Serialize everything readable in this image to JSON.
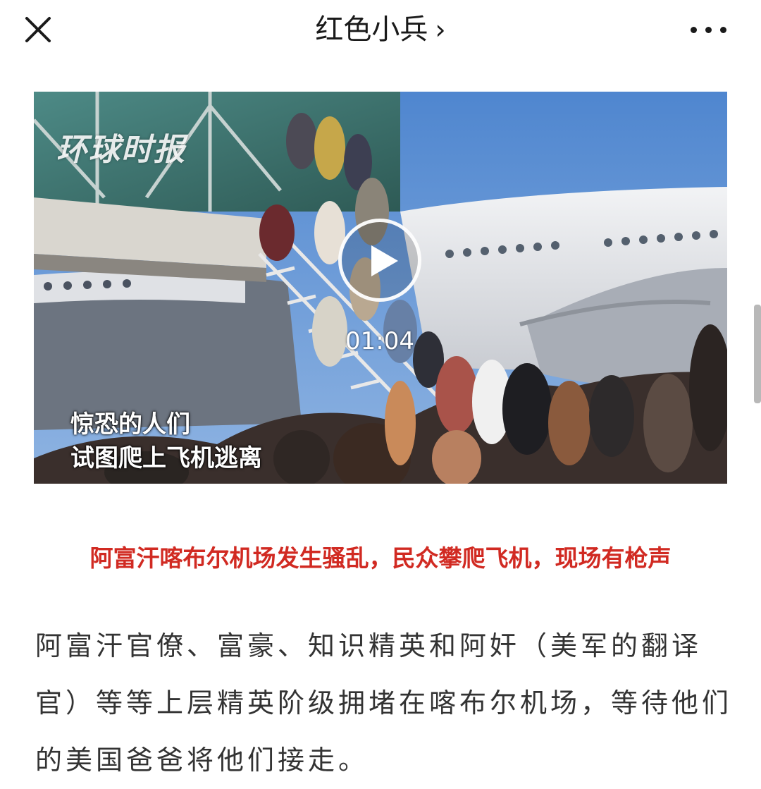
{
  "nav": {
    "title": "红色小兵",
    "chevron": "›",
    "close_icon": "close-icon",
    "more_icon": "more-icon"
  },
  "video": {
    "watermark": "环球时报",
    "caption_line1": "惊恐的人们",
    "caption_line2": "试图爬上飞机逃离",
    "duration": "01:04",
    "play_icon": "play-icon"
  },
  "article": {
    "headline": "阿富汗喀布尔机场发生骚乱，民众攀爬飞机，现场有枪声",
    "body": "阿富汗官僚、富豪、知识精英和阿奸（美军的翻译官）等等上层精英阶级拥堵在喀布尔机场，等待他们的美国爸爸将他们接走。"
  },
  "colors": {
    "headline": "#d12a22",
    "body_text": "#333333",
    "sky": "#5a8fd0"
  }
}
